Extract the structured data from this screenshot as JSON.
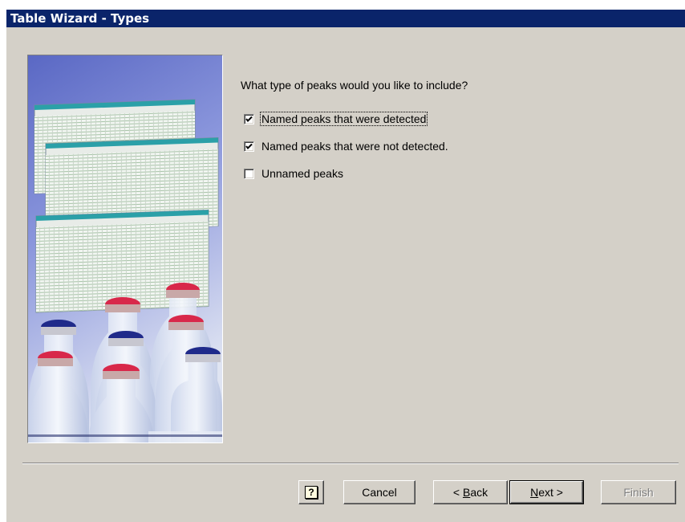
{
  "window": {
    "title": "Table Wizard - Types"
  },
  "content": {
    "question": "What type of peaks would you like to include?",
    "options": [
      {
        "label": "Named peaks that were detected",
        "checked": true,
        "focused": true
      },
      {
        "label": "Named peaks that were not detected.",
        "checked": true,
        "focused": false
      },
      {
        "label": "Unnamed peaks",
        "checked": false,
        "focused": false
      }
    ]
  },
  "buttons": {
    "help_icon": "help-question-icon",
    "help_glyph": "?",
    "cancel": "Cancel",
    "back_prefix": "< ",
    "back_mnemonic": "B",
    "back_rest": "ack",
    "next_mnemonic": "N",
    "next_rest": "ext >",
    "finish": "Finish"
  },
  "colors": {
    "title_bar": "#0a246a",
    "dialog_face": "#d4d0c8",
    "art_background": "#6f7fd0",
    "vial_cap_red": "#d8284a",
    "vial_cap_blue": "#1f2a8a"
  }
}
